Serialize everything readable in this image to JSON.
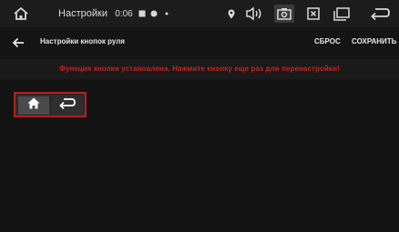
{
  "status_bar": {
    "title": "Настройки",
    "time": "0:06",
    "icons": [
      "home-icon",
      "sd-card-icon",
      "settings-dot-icon",
      "dot-icon",
      "location-icon",
      "volume-icon",
      "camera-icon",
      "close-box-icon",
      "windows-icon",
      "back-icon"
    ]
  },
  "toolbar": {
    "title": "Настройки кнопок руля",
    "reset_label": "СБРОС",
    "save_label": "СОХРАНИТЬ"
  },
  "warning": {
    "text": "Функция кнопки установлена. Нажмите кнопку еще раз для перенастройки!"
  },
  "buttons": [
    {
      "name": "home",
      "icon": "home-icon"
    },
    {
      "name": "back",
      "icon": "return-icon"
    }
  ],
  "colors": {
    "accent_red": "#b51f1f",
    "warning_red": "#c22424",
    "background": "#141414"
  }
}
